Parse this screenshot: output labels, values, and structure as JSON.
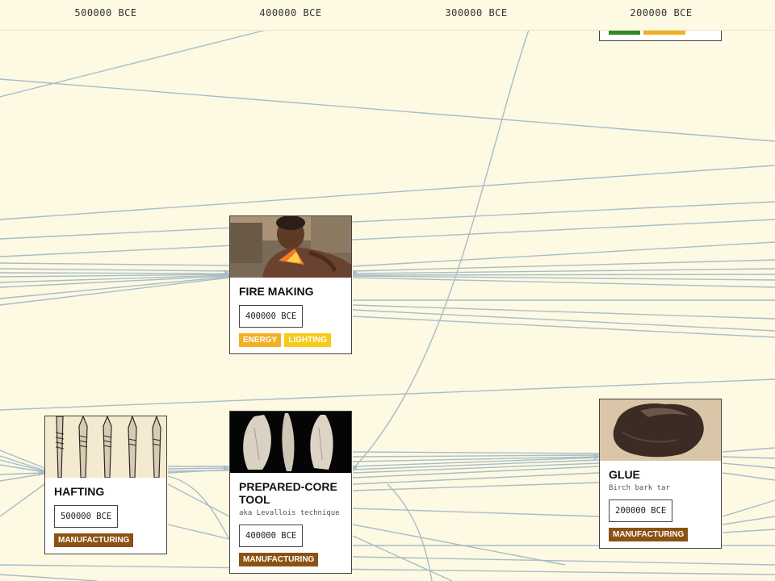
{
  "timeline": {
    "ticks": [
      "500000 BCE",
      "400000 BCE",
      "300000 BCE",
      "200000 BCE"
    ]
  },
  "colors": {
    "background": "#fdf9e3",
    "connection_line": "#a8bdc7",
    "manufacturing": "#8b5214",
    "energy": "#f2b024",
    "lighting": "#f6cb1a",
    "partial_tag_green": "#2f8a25",
    "partial_tag_yellow": "#f2b024"
  },
  "cards": {
    "fire_making": {
      "title": "FIRE MAKING",
      "date": "400000 BCE",
      "tags": [
        "ENERGY",
        "LIGHTING"
      ],
      "image": "person-blowing-fire-photo"
    },
    "hafting": {
      "title": "HAFTING",
      "date": "500000 BCE",
      "tags": [
        "MANUFACTURING"
      ],
      "image": "hafted-spearheads-illustration"
    },
    "prepared_core_tool": {
      "title": "PREPARED-CORE TOOL",
      "subtitle": "aka Levallois technique",
      "date": "400000 BCE",
      "tags": [
        "MANUFACTURING"
      ],
      "image": "stone-flakes-photo"
    },
    "glue": {
      "title": "GLUE",
      "subtitle": "Birch bark tar",
      "date": "200000 BCE",
      "tags": [
        "MANUFACTURING"
      ],
      "image": "birch-tar-lump-photo"
    }
  }
}
